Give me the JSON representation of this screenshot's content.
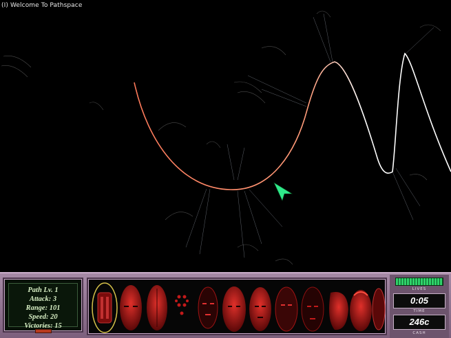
{
  "window": {
    "title": "(I) Welcome To Pathspace"
  },
  "stats": {
    "lines": [
      "Path Lv. 1",
      "Attack: 3",
      "Range: 101",
      "Speed: 20",
      "Victories: 15"
    ]
  },
  "status": {
    "lives_label": "LIVES",
    "time_label": "TIME",
    "time": "0:05",
    "cash": "246c",
    "cash_label": "CASH",
    "lives_bar_fraction": 0.85
  },
  "towers": {
    "count": 12,
    "selected_index": 0,
    "names": [
      "tower-slot-1",
      "tower-slot-2",
      "tower-slot-3",
      "tower-slot-4",
      "tower-slot-5",
      "tower-slot-6",
      "tower-slot-7",
      "tower-slot-8",
      "tower-slot-9",
      "tower-slot-10",
      "tower-slot-11",
      "tower-slot-12"
    ]
  },
  "colors": {
    "path_line": "#ffffff",
    "path_warm": "#ff9a7a",
    "cursor": "#2fe88a",
    "tower_red": "#c21a1a",
    "hud_frame": "#a68aa6"
  },
  "icons": {
    "cursor": "arrow-cursor-icon"
  }
}
